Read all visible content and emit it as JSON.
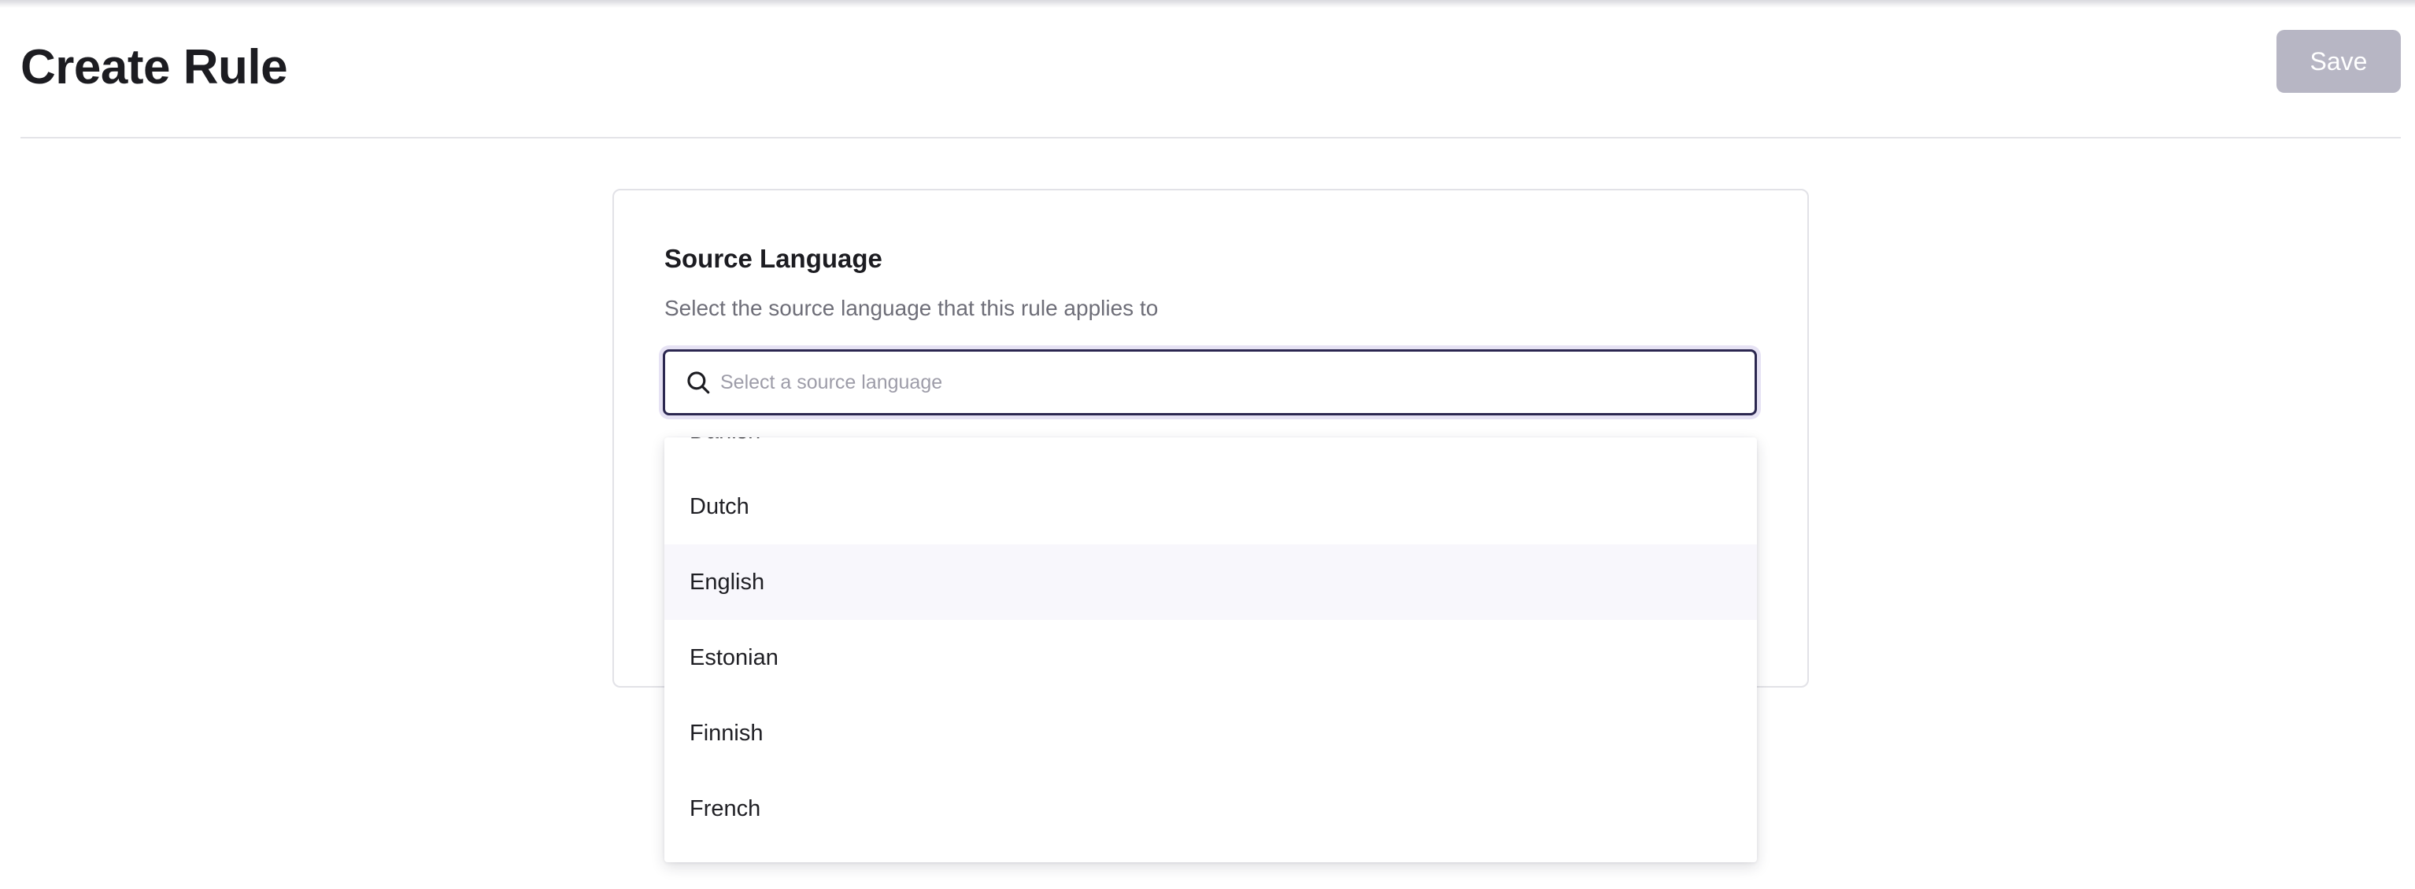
{
  "header": {
    "title": "Create Rule",
    "save_label": "Save"
  },
  "form": {
    "source_language": {
      "label": "Source Language",
      "help": "Select the source language that this rule applies to",
      "search_placeholder": "Select a source language",
      "search_value": "",
      "options": [
        {
          "label": "Danish",
          "highlighted": false
        },
        {
          "label": "Dutch",
          "highlighted": false
        },
        {
          "label": "English",
          "highlighted": true
        },
        {
          "label": "Estonian",
          "highlighted": false
        },
        {
          "label": "Finnish",
          "highlighted": false
        },
        {
          "label": "French",
          "highlighted": false
        }
      ]
    }
  },
  "colors": {
    "accent": "#2b2750",
    "save_disabled": "#b7b6c4",
    "highlight": "#f8f7fc"
  },
  "icons": {
    "search": "search-icon"
  }
}
